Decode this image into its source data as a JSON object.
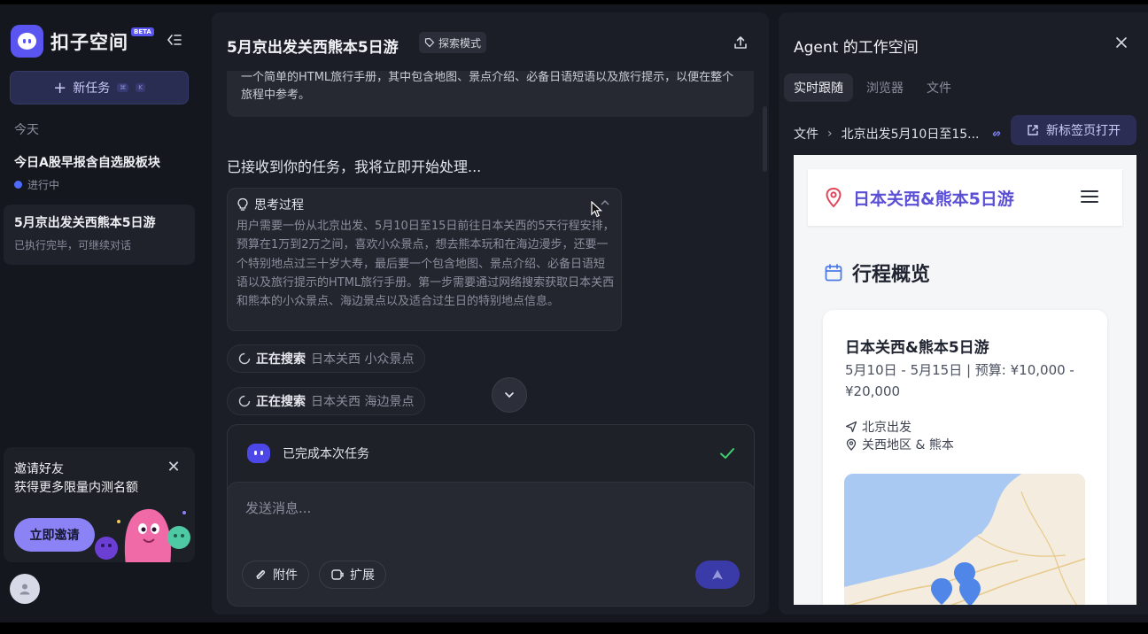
{
  "sidebar": {
    "logo_text": "扣子空间",
    "beta": "BETA",
    "new_task_label": "新任务",
    "kbd": [
      "⌘",
      "K"
    ],
    "section_today": "今天",
    "tasks": [
      {
        "title": "今日A股早报含自选股板块",
        "status": "进行中"
      },
      {
        "title": "5月京出发关西熊本5日游",
        "status": "已执行完毕，可继续对话"
      }
    ],
    "invite": {
      "title": "邀请好友",
      "subtitle": "获得更多限量内测名额",
      "button": "立即邀请"
    }
  },
  "chat": {
    "title": "5月京出发关西熊本5日游",
    "mode_badge": "探索模式",
    "user_message": "一个简单的HTML旅行手册，其中包含地图、景点介绍、必备日语短语以及旅行提示，以便在整个旅程中参考。",
    "ack": "已接收到你的任务，我将立即开始处理...",
    "thinking": {
      "title": "思考过程",
      "body": "用户需要一份从北京出发、5月10日至15日前往日本关西的5天行程安排，预算在1万到2万之间，喜欢小众景点，想去熊本玩和在海边漫步，还要一个特别地点过三十岁大寿，最后要一个包含地图、景点介绍、必备日语短语以及旅行提示的HTML旅行手册。第一步需要通过网络搜索获取日本关西和熊本的小众景点、海边景点以及适合过生日的特别地点信息。"
    },
    "searches": [
      {
        "label": "正在搜索",
        "query": "日本关西 小众景点"
      },
      {
        "label": "正在搜索",
        "query": "日本关西 海边景点"
      }
    ],
    "done_text": "已完成本次任务",
    "composer_placeholder": "发送消息...",
    "attach_label": "附件",
    "extend_label": "扩展"
  },
  "workspace": {
    "title": "Agent 的工作空间",
    "tabs": [
      "实时跟随",
      "浏览器",
      "文件"
    ],
    "active_tab": "实时跟随",
    "breadcrumb": [
      "文件",
      "北京出发5月10日至15..."
    ],
    "open_new_tab": "新标签页打开",
    "preview": {
      "nav_title": "日本关西&熊本5日游",
      "section_heading": "行程概览",
      "card_title": "日本关西&熊本5日游",
      "card_subtitle": "5月10日 - 5月15日 | 预算: ¥10,000 - ¥20,000",
      "departure": "北京出发",
      "regions": "关西地区 & 熊本"
    }
  },
  "colors": {
    "accent": "#5a55f0",
    "app_bg": "#15171f",
    "panel_bg": "#1c1e27",
    "success": "#3ecf6e",
    "preview_title": "#5b4fd6"
  }
}
